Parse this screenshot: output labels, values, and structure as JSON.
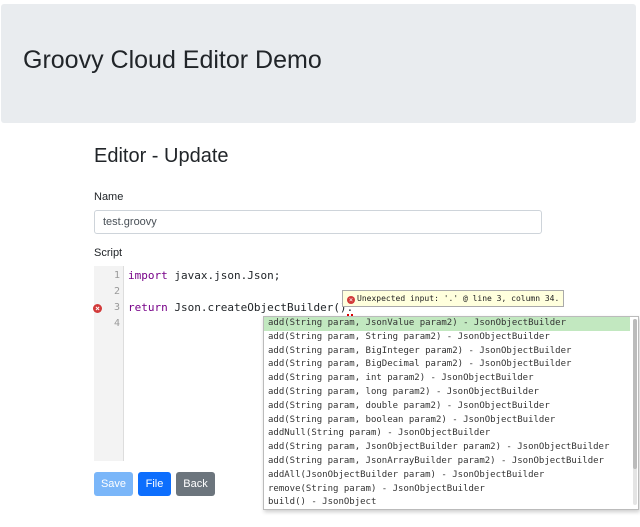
{
  "header": {
    "title": "Groovy Cloud Editor Demo"
  },
  "editor": {
    "title": "Editor - Update",
    "name_label": "Name",
    "name_value": "test.groovy",
    "script_label": "Script",
    "line_numbers": [
      "1",
      "2",
      "3",
      "4"
    ],
    "code": {
      "line1_keyword": "import",
      "line1_rest": " javax.json.Json;",
      "line3_keyword": "return",
      "line3_rest": " Json.createObjectBuilder()",
      "line3_error_char": "."
    },
    "error_tooltip": "Unexpected input: '.' @ line 3, column 34.",
    "hints": [
      "add(String param, JsonValue param2) - JsonObjectBuilder",
      "add(String param, String param2) - JsonObjectBuilder",
      "add(String param, BigInteger param2) - JsonObjectBuilder",
      "add(String param, BigDecimal param2) - JsonObjectBuilder",
      "add(String param, int param2) - JsonObjectBuilder",
      "add(String param, long param2) - JsonObjectBuilder",
      "add(String param, double param2) - JsonObjectBuilder",
      "add(String param, boolean param2) - JsonObjectBuilder",
      "addNull(String param) - JsonObjectBuilder",
      "add(String param, JsonObjectBuilder param2) - JsonObjectBuilder",
      "add(String param, JsonArrayBuilder param2) - JsonObjectBuilder",
      "addAll(JsonObjectBuilder param) - JsonObjectBuilder",
      "remove(String param) - JsonObjectBuilder",
      "build() - JsonObject"
    ]
  },
  "buttons": {
    "save": "Save",
    "file": "File",
    "back": "Back"
  },
  "colors": {
    "primary": "#0d6efd",
    "primary_disabled": "#7ab6f9",
    "secondary": "#6c757d",
    "error": "#d23a3a",
    "hint_active": "#c2e8c0"
  }
}
